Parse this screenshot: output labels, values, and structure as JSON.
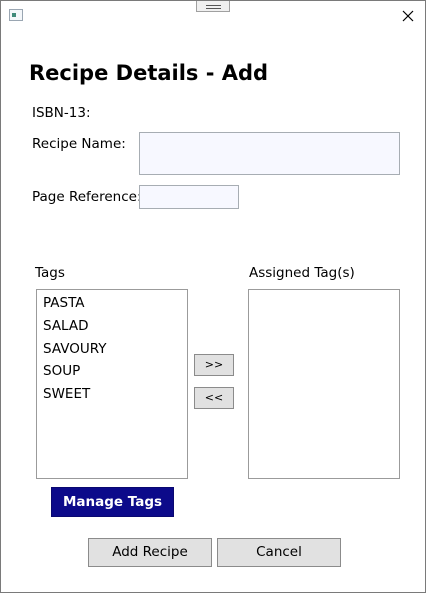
{
  "window": {
    "close_glyph": "✕",
    "icons": {
      "app": "window-app-icon",
      "grip": "resize-grip-icon",
      "close": "close-icon"
    }
  },
  "form": {
    "heading": "Recipe Details - Add",
    "isbn_label": "ISBN-13:",
    "recipe_name_label": "Recipe Name:",
    "recipe_name_value": "",
    "page_reference_label": "Page Reference:",
    "page_reference_value": ""
  },
  "tags": {
    "available_label": "Tags",
    "assigned_label": "Assigned Tag(s)",
    "available_items": [
      "PASTA",
      "SALAD",
      "SAVOURY",
      "SOUP",
      "SWEET"
    ],
    "assigned_items": [],
    "move_right_label": ">>",
    "move_left_label": "<<",
    "manage_label": "Manage Tags"
  },
  "actions": {
    "add_label": "Add Recipe",
    "cancel_label": "Cancel"
  },
  "colors": {
    "manage_button_bg": "#0c0a8a",
    "textbox_bg": "#f7f8ff",
    "button_bg": "#e1e1e1"
  }
}
